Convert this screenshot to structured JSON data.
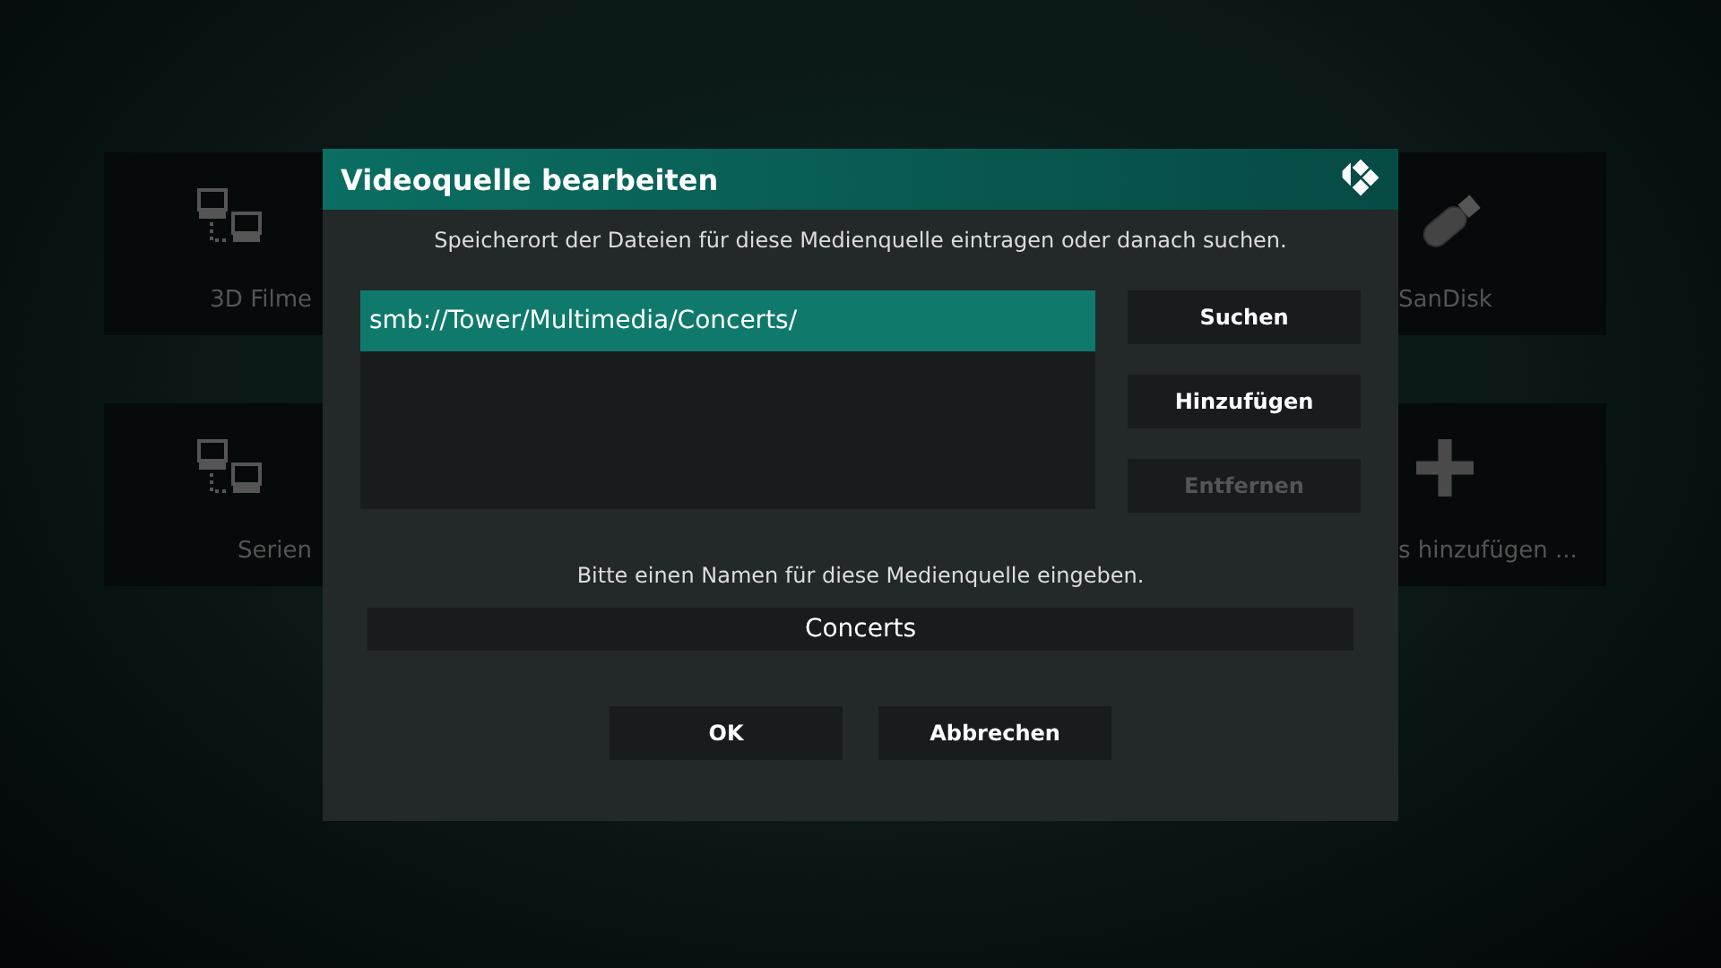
{
  "background_tiles": [
    {
      "label": "3D Filme",
      "kind": "network"
    },
    {
      "label": "SanDisk",
      "kind": "usb"
    },
    {
      "label": "Serien",
      "kind": "network"
    },
    {
      "label": "s hinzufügen ...",
      "kind": "add"
    }
  ],
  "dialog": {
    "title": "Videoquelle bearbeiten",
    "path_hint": "Speicherort der Dateien für diese Medienquelle eintragen oder danach suchen.",
    "paths": [
      {
        "text": "smb://Tower/Multimedia/Concerts/",
        "selected": true
      }
    ],
    "side_buttons": [
      {
        "label": "Suchen",
        "disabled": false
      },
      {
        "label": "Hinzufügen",
        "disabled": false
      },
      {
        "label": "Entfernen",
        "disabled": true
      }
    ],
    "name_hint": "Bitte einen Namen für diese Medienquelle eingeben.",
    "name_field": {
      "value": "Concerts"
    },
    "buttons": [
      {
        "label": "OK"
      },
      {
        "label": "Abbrechen"
      }
    ]
  }
}
